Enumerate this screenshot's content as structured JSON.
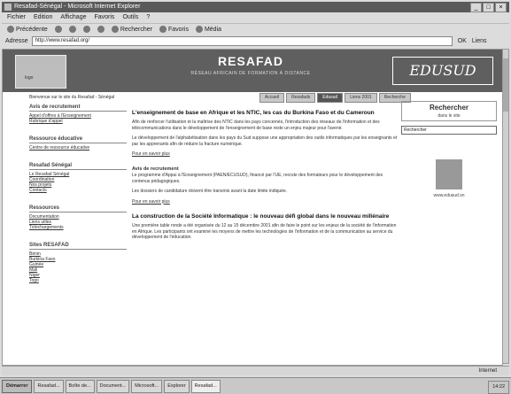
{
  "window": {
    "title": "Resafad-Sénégal - Microsoft Internet Explorer",
    "buttons": [
      "_",
      "□",
      "×"
    ]
  },
  "menu": [
    "Fichier",
    "Edition",
    "Affichage",
    "Favoris",
    "Outils",
    "?"
  ],
  "toolbar": {
    "back": "Précédente",
    "search": "Rechercher",
    "favorites": "Favoris",
    "media": "Média"
  },
  "address": {
    "label": "Adresse",
    "url": "http://www.resafad.org/",
    "go": "OK",
    "links": "Liens"
  },
  "banner": {
    "title": "RESAFAD",
    "subtitle": "RÉSEAU AFRICAIN DE FORMATION À DISTANCE",
    "logo_text": "EDUSUD"
  },
  "breadcrumb": "Bienvenue sur le site du Resafad - Sénégal",
  "nav": [
    "Accueil",
    "Resafads",
    "Edusud",
    "Liens 2001",
    "Recherche"
  ],
  "sidebar": [
    {
      "title": "Avis de recrutement",
      "links": [
        "Appel d'offres à l'Enseignement",
        "Rubrique d'appel"
      ]
    },
    {
      "title": "Ressource éducative",
      "links": [
        "Centre de ressource éducative"
      ]
    },
    {
      "title": "Resafad Sénégal",
      "links": [
        "Le Resafad Sénégal",
        "Coordination",
        "Nos projets",
        "Contacts"
      ]
    },
    {
      "title": "Ressources",
      "links": [
        "Documentation",
        "Liens utiles",
        "Téléchargements"
      ]
    },
    {
      "title": "Sites RESAFAD",
      "links": [
        "Bénin",
        "Burkina Faso",
        "Guinée",
        "Mali",
        "Niger",
        "Togo"
      ]
    }
  ],
  "main": {
    "h1": "L'enseignement de base en Afrique et les NTIC, les cas du Burkina Faso et du Cameroun",
    "p1": "Afin de renforcer l'utilisation et la maîtrise des NTIC dans les pays concernés, l'introduction des réseaux de l'information et des télécommunications dans le développement de l'enseignement de base reste un enjeu majeur pour l'avenir.",
    "p2": "Le développement de l'alphabétisation dans les pays du Sud suppose une appropriation des outils informatiques par les enseignants et par les apprenants afin de réduire la fracture numérique.",
    "link1": "Pour en savoir plus",
    "h2": "Avis de recrutement",
    "p3": "Le programme d'Appui à l'Enseignement (PAEN/ECUSUD), financé par l'UE, recrute des formateurs pour le développement des contenus pédagogiques.",
    "p4": "Les dossiers de candidature doivent être transmis avant la date limite indiquée.",
    "link2": "Pour en savoir plus",
    "h3": "La construction de la Société Informatique : le nouveau défi global dans le nouveau millénaire",
    "p5": "Une première table ronde a été organisée du 12 au 15 décembre 2001 afin de faire le point sur les enjeux de la société de l'information en Afrique. Les participants ont examiné les moyens de mettre les technologies de l'information et de la communication au service du développement de l'éducation."
  },
  "right": {
    "search_title": "Rechercher",
    "search_sub": "dans le site",
    "search_placeholder": "Rechercher",
    "caption": "www.edusud.sn"
  },
  "status": {
    "left": "",
    "zone": "Internet"
  },
  "taskbar": {
    "start": "Démarrer",
    "tasks": [
      "Resafad...",
      "Boîte de...",
      "Document...",
      "Microsoft...",
      "Explorer",
      "Resafad..."
    ],
    "tray": "14:22"
  }
}
